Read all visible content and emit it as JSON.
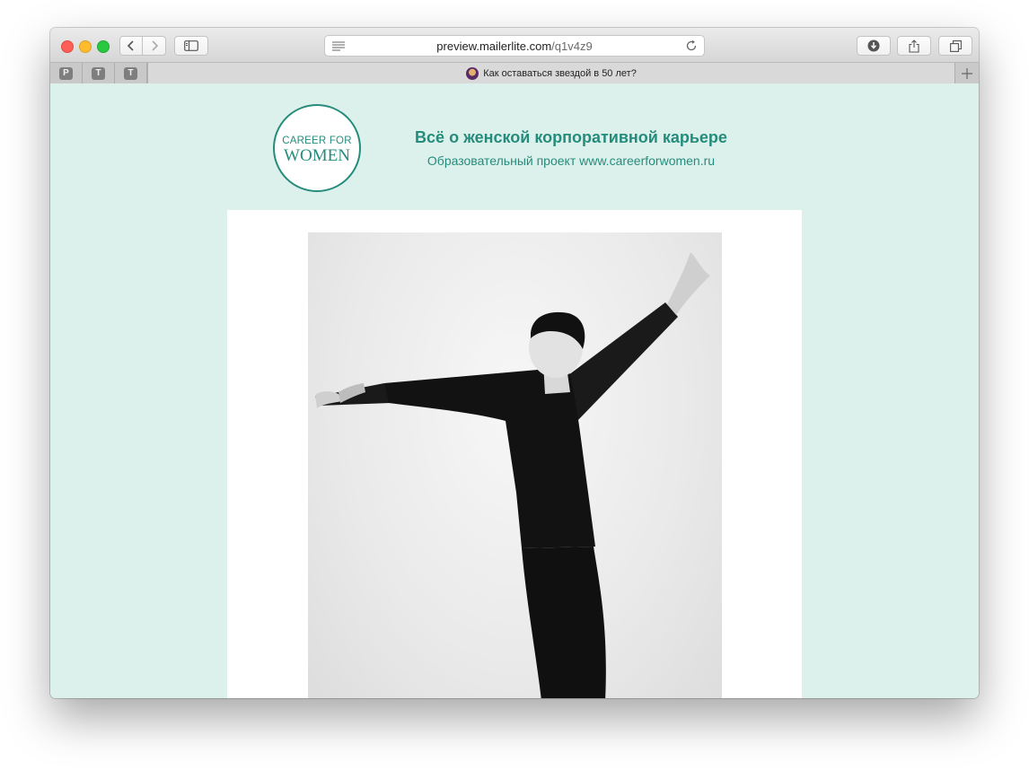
{
  "browser": {
    "url_host": "preview.mailerlite.com",
    "url_path": "/q1v4z9",
    "pinned_tabs": [
      {
        "letter": "P"
      },
      {
        "letter": "T"
      },
      {
        "letter": "T"
      }
    ],
    "active_tab": {
      "title": "Как оставаться звездой в 50 лет?"
    }
  },
  "email": {
    "logo": {
      "line1": "CAREER FOR",
      "line2": "WOMEN"
    },
    "headline": "Всё о женской корпоративной карьере",
    "subline": "Образовательный проект www.careerforwomen.ru",
    "brand_color": "#258c7c",
    "background_color": "#ddf1ec"
  }
}
